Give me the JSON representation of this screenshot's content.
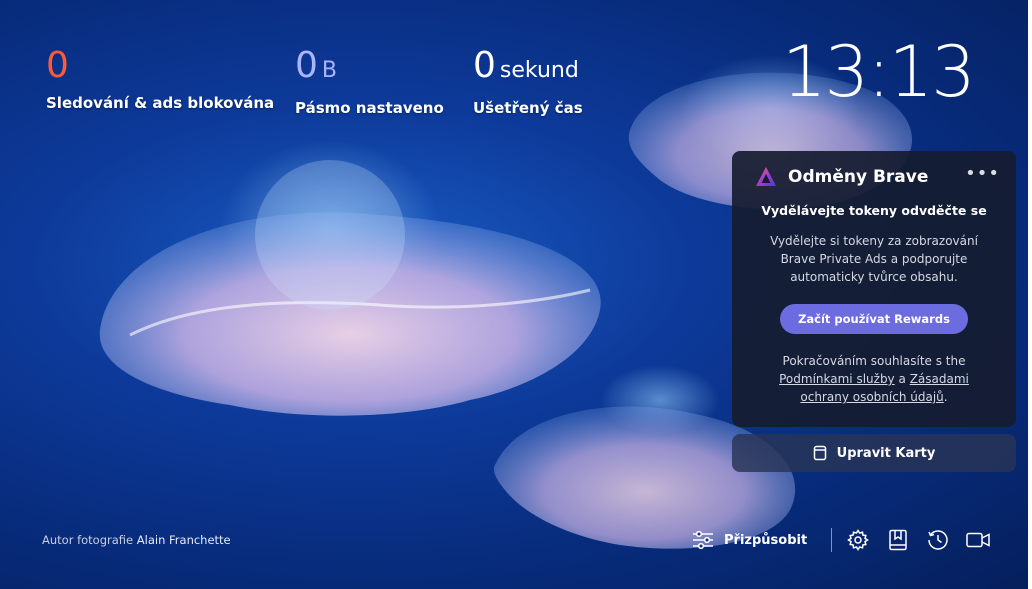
{
  "stats": [
    {
      "value": "0",
      "unit": "",
      "label": "Sledování & ads blokována",
      "color": "#ff5a36"
    },
    {
      "value": "0",
      "unit": "B",
      "label": "Pásmo nastaveno",
      "color": "#aab4ff"
    },
    {
      "value": "0",
      "unit": "sekund",
      "label": "Ušetřený čas",
      "color": "#ffffff"
    }
  ],
  "clock": "13:13",
  "rewards": {
    "title": "Odměny Brave",
    "menu": "•••",
    "subtitle": "Vydělávejte tokeny odvděčte se",
    "body": "Vydělejte si tokeny za zobrazování Brave Private Ads a podporujte automaticky tvůrce obsahu.",
    "button": "Začít používat Rewards",
    "legal_prefix": "Pokračováním souhlasíte s the",
    "terms_link": "Podmínkami služby",
    "legal_and": "a",
    "privacy_link": "Zásadami ochrany osobních údajů",
    "legal_suffix": "."
  },
  "edit_cards": "Upravit Karty",
  "credit": {
    "prefix": "Autor fotografie",
    "name": "Alain Franchette"
  },
  "toolbar": {
    "customize": "Přizpůsobit",
    "icons": [
      "settings-icon",
      "bookmarks-icon",
      "history-icon",
      "brave-talk-icon"
    ]
  },
  "colors": {
    "accent_button": "#6d6be0",
    "card_bg": "#161c30"
  }
}
